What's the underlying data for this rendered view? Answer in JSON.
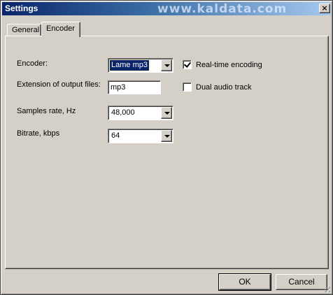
{
  "window": {
    "title": "Settings",
    "watermark": "www.kaldata.com",
    "close_glyph": "×"
  },
  "tabs": [
    {
      "label": "General",
      "active": false
    },
    {
      "label": "Encoder",
      "active": true
    }
  ],
  "encoder_tab": {
    "encoder": {
      "label": "Encoder:",
      "value": "Lame mp3"
    },
    "extension": {
      "label": "Extension of output files:",
      "value": "mp3"
    },
    "samples_rate": {
      "label": "Samples rate, Hz",
      "value": "48,000"
    },
    "bitrate": {
      "label": "Bitrate, kbps",
      "value": "64"
    },
    "realtime_encoding": {
      "label": "Real-time encoding",
      "checked": true
    },
    "dual_audio_track": {
      "label": "Dual audio track",
      "checked": false
    }
  },
  "buttons": {
    "ok": "OK",
    "cancel": "Cancel"
  },
  "icons": {
    "dropdown": "chevron-down-icon",
    "check": "checkmark-icon",
    "close": "close-icon"
  },
  "colors": {
    "titlebar_start": "#0a246a",
    "titlebar_end": "#a6caf0",
    "face": "#d4d0c8",
    "selection": "#0a246a"
  }
}
